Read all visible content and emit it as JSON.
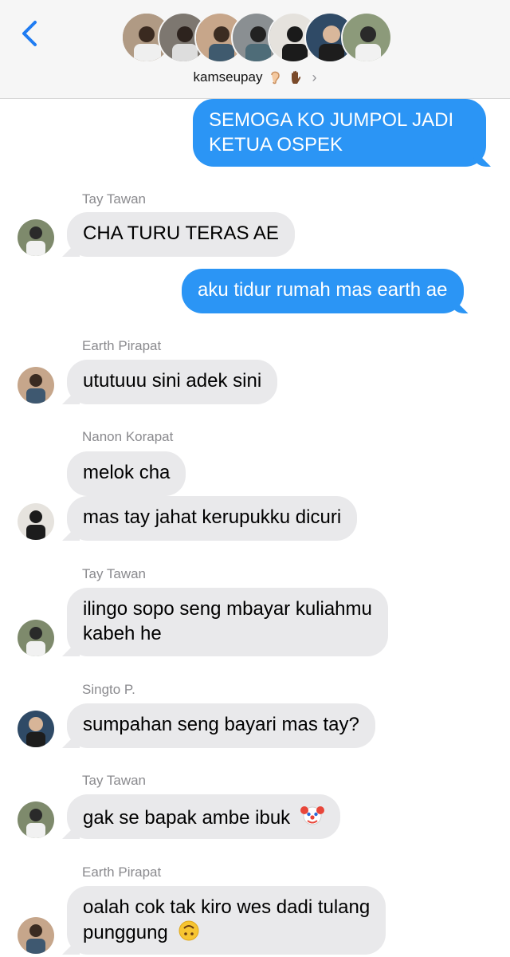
{
  "header": {
    "group_name": "kamseupay",
    "back_icon": "chevron-left-icon",
    "info_chevron": "›",
    "participants": 7
  },
  "colors": {
    "outgoing_bubble": "#2b95f5",
    "incoming_bubble": "#e9e9eb",
    "back_icon": "#1f7cf2",
    "sender_label": "#8a8a8e"
  },
  "messages": [
    {
      "direction": "out",
      "text_lines": [
        "SEMOGA KO JUMPOL JADI",
        "KETUA OSPEK"
      ]
    },
    {
      "direction": "in",
      "sender": "Tay Tawan",
      "text_lines": [
        "CHA TURU TERAS AE"
      ]
    },
    {
      "direction": "out",
      "text_lines": [
        "aku tidur rumah mas earth ae"
      ]
    },
    {
      "direction": "in",
      "sender": "Earth Pirapat",
      "text_lines": [
        "ututuuu sini adek sini"
      ]
    },
    {
      "direction": "in",
      "sender": "Nanon Korapat",
      "text_lines": [
        "melok cha"
      ]
    },
    {
      "direction": "in",
      "text_lines": [
        "mas tay jahat kerupukku dicuri"
      ]
    },
    {
      "direction": "in",
      "sender": "Tay Tawan",
      "text_lines": [
        "ilingo sopo seng mbayar kuliahmu",
        "kabeh he"
      ]
    },
    {
      "direction": "in",
      "sender": "Singto P.",
      "text_lines": [
        "sumpahan seng bayari mas tay?"
      ]
    },
    {
      "direction": "in",
      "sender": "Tay Tawan",
      "text_lines": [
        "gak se bapak ambe ibuk"
      ],
      "emoji": "clown-face"
    },
    {
      "direction": "in",
      "sender": "Earth Pirapat",
      "text_lines": [
        "oalah cok tak kiro wes dadi tulang",
        "punggung"
      ],
      "emoji": "upside-down-face"
    }
  ]
}
